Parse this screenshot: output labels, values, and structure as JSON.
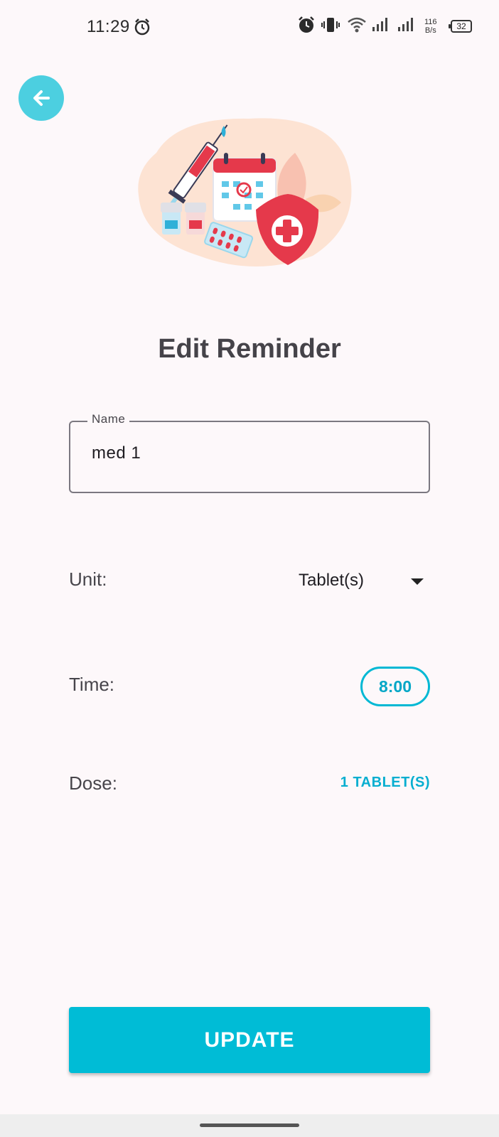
{
  "status_bar": {
    "time": "11:29",
    "network_speed_value": "116",
    "network_speed_unit": "B/s",
    "battery_level": "32",
    "icons": [
      "alarm-icon",
      "alarm-icon",
      "vibrate-icon",
      "wifi-icon",
      "signal-icon",
      "signal-icon",
      "battery-icon"
    ]
  },
  "header": {
    "back_icon": "arrow-left-icon",
    "illustration": "medical-reminder-illustration"
  },
  "page": {
    "title": "Edit Reminder"
  },
  "form": {
    "name_label": "Name",
    "name_value": "med 1",
    "unit_label": "Unit:",
    "unit_value": "Tablet(s)",
    "time_label": "Time:",
    "time_value": "8:00",
    "dose_label": "Dose:",
    "dose_value": "1 TABLET(S)"
  },
  "actions": {
    "update_label": "UPDATE"
  },
  "colors": {
    "accent": "#00bcd6",
    "back_button": "#4ccfe0",
    "background": "#fdf8fa",
    "title": "#454349"
  }
}
